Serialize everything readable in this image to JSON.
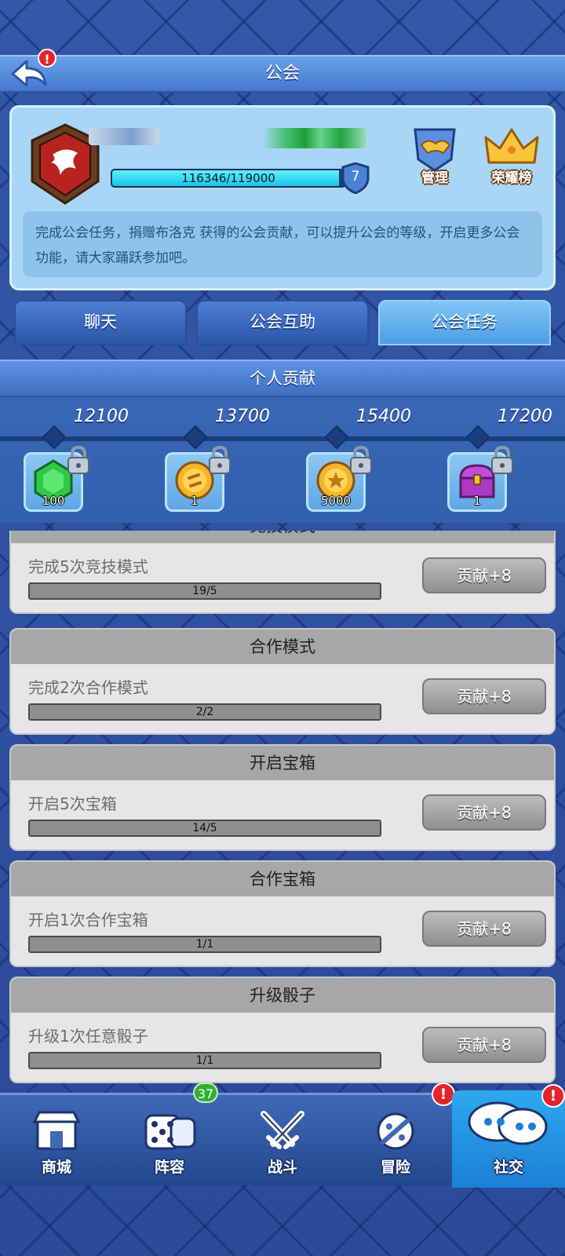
{
  "header": {
    "title": "公会"
  },
  "guild": {
    "xp_text": "116346/119000",
    "xp_progress": 0.9777,
    "level": "7",
    "description": "完成公会任务，捐赠布洛克 获得的公会贡献，可以提升公会的等级，开启更多公会功能，请大家踊跃参加吧。",
    "actions": [
      {
        "label": "管理",
        "icon": "handshake-shield-icon"
      },
      {
        "label": "荣耀榜",
        "icon": "crown-icon"
      }
    ]
  },
  "tabs": [
    {
      "label": "聊天",
      "active": false
    },
    {
      "label": "公会互助",
      "active": false
    },
    {
      "label": "公会任务",
      "active": true
    }
  ],
  "personal": {
    "title": "个人贡献",
    "milestones": [
      {
        "value": "12100",
        "reward_qty": "100",
        "reward_icon": "green-gem-icon",
        "locked": true
      },
      {
        "value": "13700",
        "reward_qty": "1",
        "reward_icon": "gold-coin-swap-icon",
        "locked": true
      },
      {
        "value": "15400",
        "reward_qty": "5000",
        "reward_icon": "gold-coin-star-icon",
        "locked": true
      },
      {
        "value": "17200",
        "reward_qty": "1",
        "reward_icon": "treasure-chest-icon",
        "locked": true
      }
    ]
  },
  "tasks": [
    {
      "category": "竞技模式",
      "description": "完成5次竞技模式",
      "progress_text": "19/5",
      "progress": 1.0,
      "button": "贡献+8"
    },
    {
      "category": "合作模式",
      "description": "完成2次合作模式",
      "progress_text": "2/2",
      "progress": 1.0,
      "button": "贡献+8"
    },
    {
      "category": "开启宝箱",
      "description": "开启5次宝箱",
      "progress_text": "14/5",
      "progress": 1.0,
      "button": "贡献+8"
    },
    {
      "category": "合作宝箱",
      "description": "开启1次合作宝箱",
      "progress_text": "1/1",
      "progress": 1.0,
      "button": "贡献+8"
    },
    {
      "category": "升级骰子",
      "description": "升级1次任意骰子",
      "progress_text": "1/1",
      "progress": 1.0,
      "button": "贡献+8"
    }
  ],
  "nav": [
    {
      "label": "商城",
      "icon": "shop-icon",
      "active": false,
      "badge": null,
      "alert": false
    },
    {
      "label": "阵容",
      "icon": "dice-icon",
      "active": false,
      "badge": "37",
      "alert": false
    },
    {
      "label": "战斗",
      "icon": "crossed-swords-icon",
      "active": false,
      "badge": null,
      "alert": false
    },
    {
      "label": "冒险",
      "icon": "adventure-icon",
      "active": false,
      "badge": null,
      "alert": true
    },
    {
      "label": "社交",
      "icon": "chat-bubbles-icon",
      "active": true,
      "badge": null,
      "alert": true
    }
  ],
  "alerts": {
    "back": "!",
    "nav": "!"
  },
  "colors": {
    "accent": "#4d9ee6",
    "alert": "#e5232a",
    "badge": "#2fb12f"
  }
}
